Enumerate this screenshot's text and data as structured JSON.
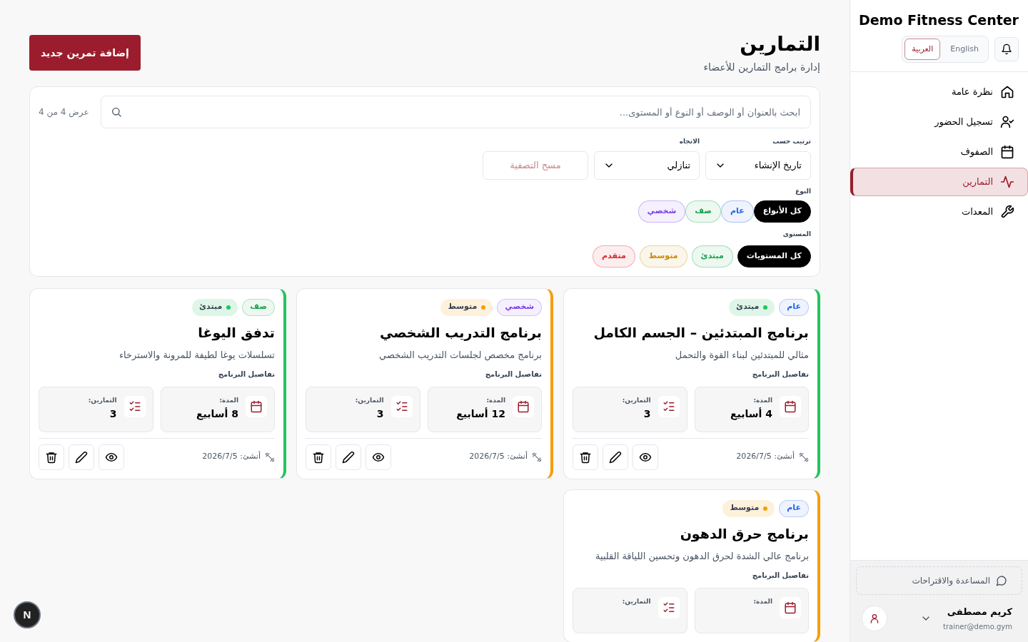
{
  "sidebar": {
    "brand": "Demo Fitness Center",
    "languages": [
      {
        "label": "English",
        "selected": false
      },
      {
        "label": "العربية",
        "selected": true
      }
    ],
    "nav": [
      {
        "label": "نظرة عامة",
        "kind": "home",
        "selected": false
      },
      {
        "label": "تسجيل الحضور",
        "kind": "attendance",
        "selected": false
      },
      {
        "label": "الصفوف",
        "kind": "classes",
        "selected": false
      },
      {
        "label": "التمارين",
        "kind": "workouts",
        "selected": true
      },
      {
        "label": "المعدات",
        "kind": "equipment",
        "selected": false
      }
    ],
    "help": "المساعدة والاقتراحات",
    "user": {
      "name": "كريم مصطفى",
      "email": "trainer@demo.gym"
    }
  },
  "header": {
    "title": "التمارين",
    "subtitle": "إدارة برامج التمارين للأعضاء",
    "add_button": "إضافة تمرين جديد"
  },
  "filters": {
    "search_placeholder": "ابحث بالعنوان أو الوصف أو النوع أو المستوى...",
    "count": "عرض 4 من 4",
    "sort_label": "ترتيب حسب",
    "sort_value": "تاريخ الإنشاء",
    "direction_label": "الاتجاه",
    "direction_value": "تنازلي",
    "clear": "مسح التصفية",
    "type_label": "النوع",
    "types": [
      {
        "label": "كل الأنواع",
        "selected": true
      },
      {
        "label": "عام",
        "selected": false,
        "color": "#2563eb"
      },
      {
        "label": "صف",
        "selected": false,
        "color": "#16a34a"
      },
      {
        "label": "شخصي",
        "selected": false,
        "color": "#7c3aed"
      }
    ],
    "level_label": "المستوى",
    "levels": [
      {
        "label": "كل المستويات",
        "selected": true
      },
      {
        "label": "مبتدئ",
        "selected": false,
        "color": "#16a34a"
      },
      {
        "label": "متوسط",
        "selected": false,
        "color": "#ca8a04"
      },
      {
        "label": "متقدم",
        "selected": false,
        "color": "#dc2626"
      }
    ]
  },
  "programs": [
    {
      "type": {
        "label": "عام",
        "color": "#2563eb"
      },
      "level": {
        "label": "مبتدئ",
        "color": "#22c55e"
      },
      "title": "برنامج المبتدئين – الجسم الكامل",
      "description": "مثالي للمبتدئين لبناء القوة والتحمل",
      "details_label": "تفاصيل البرنامج",
      "duration_label": "المدة:",
      "duration": "4 أسابيع",
      "exercises_label": "التمارين:",
      "exercises": "3",
      "created": "أنشئ: 2026/7/5"
    },
    {
      "type": {
        "label": "شخصي",
        "color": "#7c3aed"
      },
      "level": {
        "label": "متوسط",
        "color": "#f59e0b"
      },
      "title": "برنامج التدريب الشخصي",
      "description": "برنامج مخصص لجلسات التدريب الشخصي",
      "details_label": "تفاصيل البرنامج",
      "duration_label": "المدة:",
      "duration": "12 أسابيع",
      "exercises_label": "التمارين:",
      "exercises": "3",
      "created": "أنشئ: 2026/7/5"
    },
    {
      "type": {
        "label": "صف",
        "color": "#16a34a"
      },
      "level": {
        "label": "مبتدئ",
        "color": "#22c55e"
      },
      "title": "تدفق اليوغا",
      "description": "تسلسلات يوغا لطيفة للمرونة والاسترخاء",
      "details_label": "تفاصيل البرنامج",
      "duration_label": "المدة:",
      "duration": "8 أسابيع",
      "exercises_label": "التمارين:",
      "exercises": "3",
      "created": "أنشئ: 2026/7/5"
    },
    {
      "type": {
        "label": "عام",
        "color": "#2563eb"
      },
      "level": {
        "label": "متوسط",
        "color": "#f59e0b"
      },
      "title": "برنامج حرق الدهون",
      "description": "برنامج عالي الشدة لحرق الدهون وتحسين اللياقة القلبية",
      "details_label": "تفاصيل البرنامج",
      "duration_label": "المدة:",
      "exercises_label": "التمارين:"
    }
  ],
  "dev_badge": "N"
}
